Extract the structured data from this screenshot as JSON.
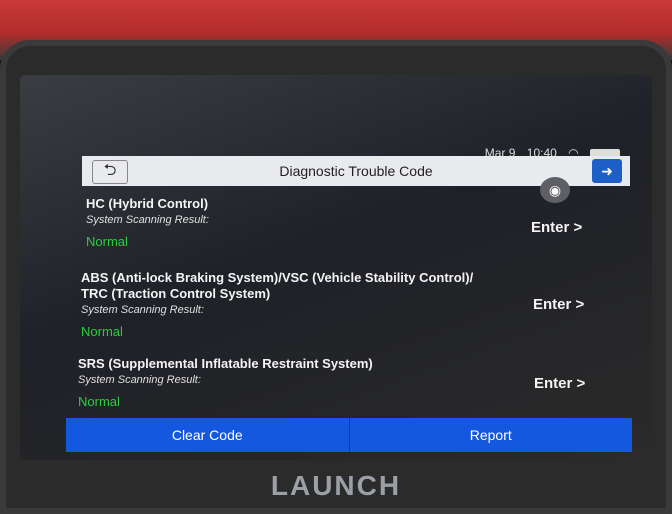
{
  "status": {
    "date": "Mar 9",
    "time": "10:40"
  },
  "header": {
    "title": "Diagnostic Trouble Code",
    "back_icon": "back-arrow-icon",
    "exit_icon": "exit-icon",
    "camera_icon": "camera-icon"
  },
  "systems": [
    {
      "title": "HC (Hybrid Control)",
      "subtitle": "System Scanning Result:",
      "status": "Normal",
      "enter": "Enter >"
    },
    {
      "title": "ABS (Anti-lock Braking System)/VSC (Vehicle Stability Control)/ TRC (Traction Control System)",
      "subtitle": "System Scanning Result:",
      "status": "Normal",
      "enter": "Enter >"
    },
    {
      "title": "SRS (Supplemental Inflatable Restraint System)",
      "subtitle": "System Scanning Result:",
      "status": "Normal",
      "enter": "Enter >"
    }
  ],
  "buttons": {
    "clear": "Clear Code",
    "report": "Report"
  },
  "brand": "LAUNCH",
  "colors": {
    "accent": "#1558e0",
    "status_ok": "#2ecc40"
  }
}
